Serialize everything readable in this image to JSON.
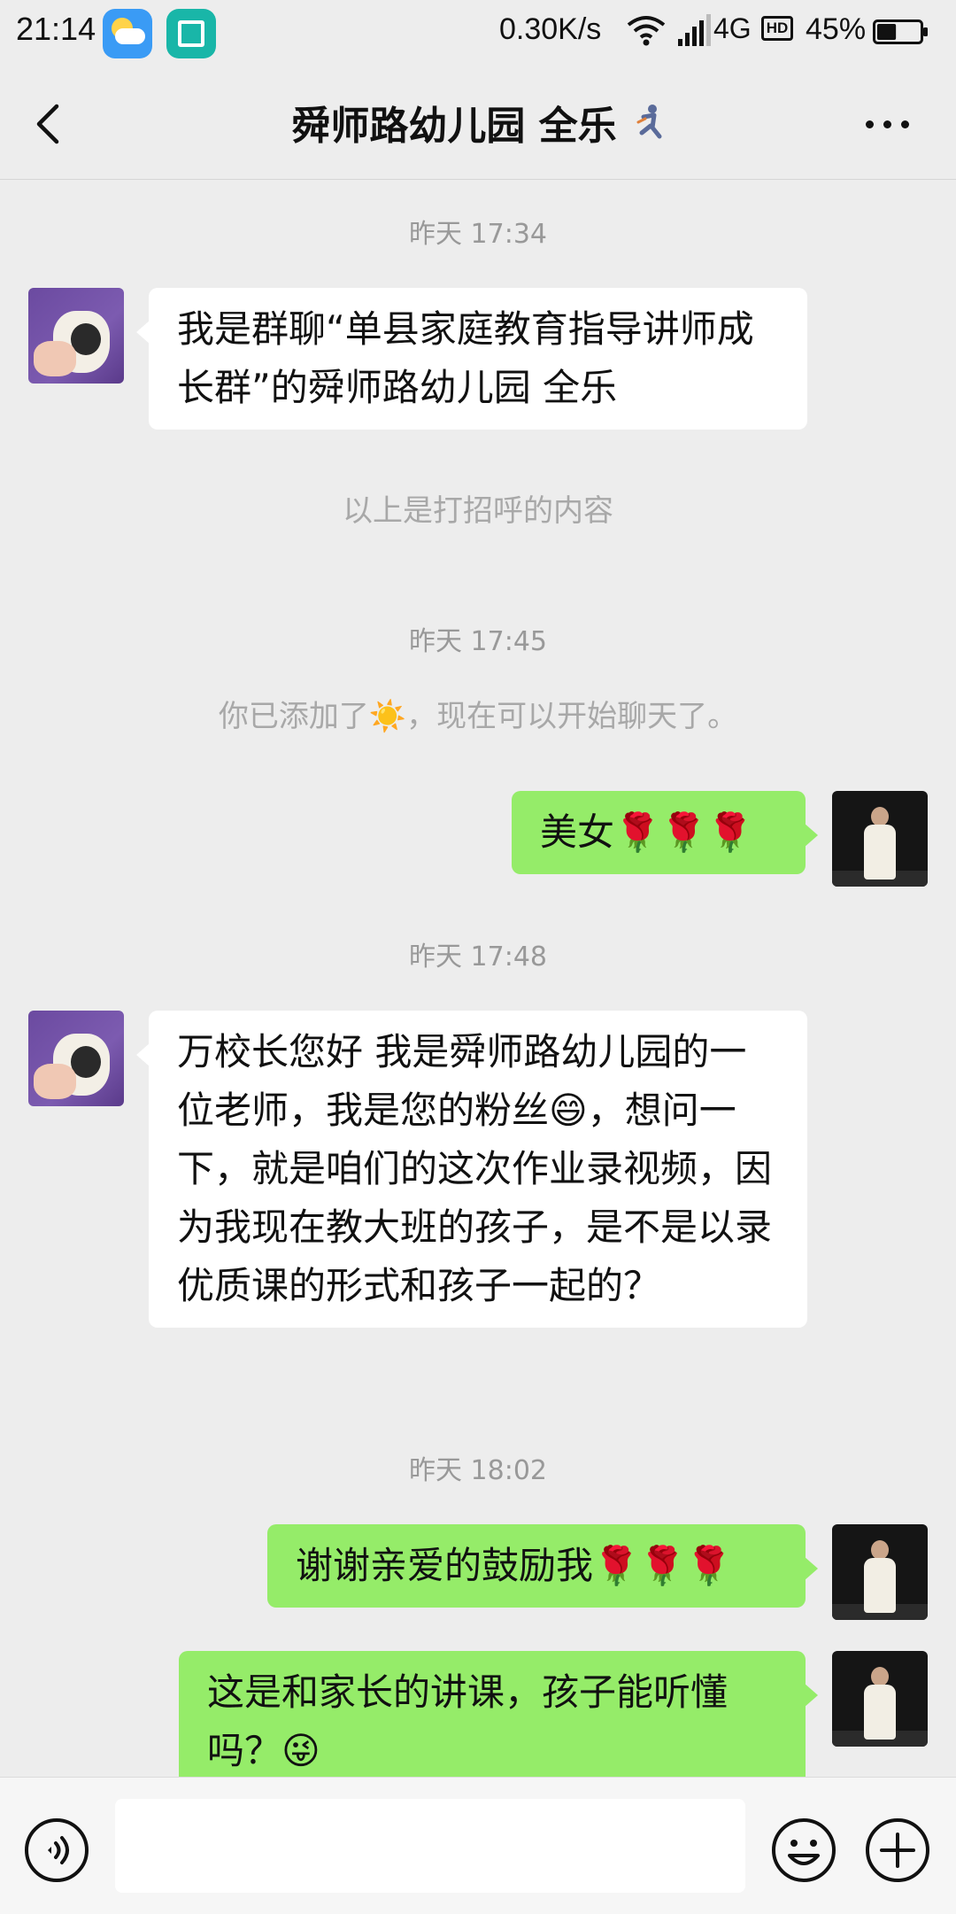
{
  "status_bar": {
    "time": "21:14",
    "net_speed": "0.30K/s",
    "net_type": "4G",
    "hd_label": "HD",
    "battery_percent": "45%",
    "battery_level": 0.45
  },
  "header": {
    "title": "舜师路幼儿园 全乐",
    "icon": "runner-icon"
  },
  "messages": [
    {
      "type": "timestamp",
      "text": "昨天 17:34"
    },
    {
      "type": "incoming",
      "text": "我是群聊“单县家庭教育指导讲师成长群”的舜师路幼儿园 全乐"
    },
    {
      "type": "system",
      "text": "以上是打招呼的内容"
    },
    {
      "type": "timestamp",
      "text": "昨天 17:45"
    },
    {
      "type": "system",
      "text": "你已添加了☀️，现在可以开始聊天了。"
    },
    {
      "type": "outgoing",
      "text": "美女🌹🌹🌹"
    },
    {
      "type": "timestamp",
      "text": "昨天 17:48"
    },
    {
      "type": "incoming",
      "text": "万校长您好 我是舜师路幼儿园的一位老师，我是您的粉丝😄，想问一下，就是咱们的这次作业录视频，因为我现在教大班的孩子，是不是以录优质课的形式和孩子一起的？"
    },
    {
      "type": "timestamp",
      "text": "昨天 18:02"
    },
    {
      "type": "outgoing",
      "text": "谢谢亲爱的鼓励我🌹🌹🌹"
    },
    {
      "type": "outgoing",
      "text": "这是和家长的讲课，孩子能听懂吗？😜"
    }
  ],
  "input_bar": {
    "voice_icon": "voice-icon",
    "emoji_icon": "emoji-icon",
    "plus_icon": "plus-icon",
    "input_value": ""
  }
}
